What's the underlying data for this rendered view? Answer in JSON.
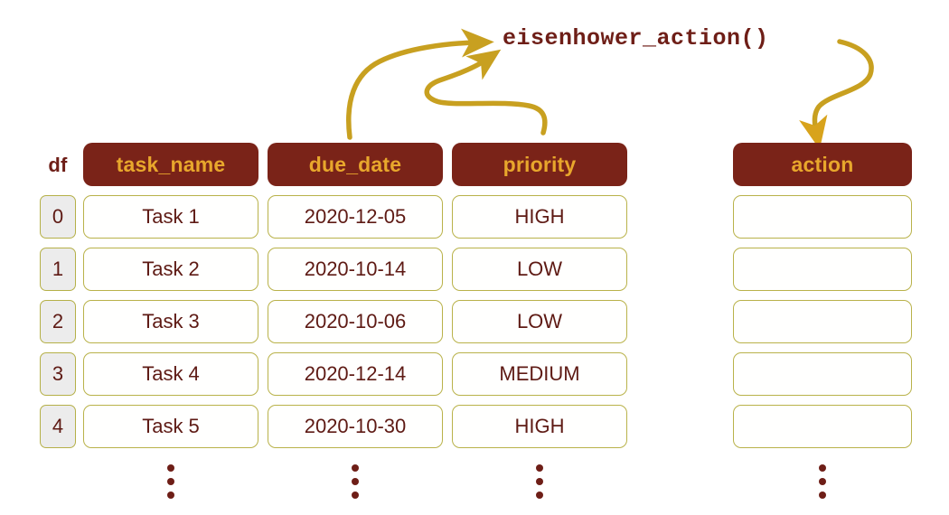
{
  "diagram": {
    "function_label": "eisenhower_action()",
    "dataframe_label": "df",
    "colors": {
      "header_bg": "#7A2318",
      "header_text": "#E8A72C",
      "cell_border": "#B9B24A",
      "cell_text": "#5E1A14",
      "index_bg": "#ECECEC",
      "arrow": "#C8A020",
      "background": "#FFFFFF"
    }
  },
  "source_table": {
    "name": "df",
    "columns": [
      "task_name",
      "due_date",
      "priority"
    ],
    "index": [
      "0",
      "1",
      "2",
      "3",
      "4"
    ],
    "rows": [
      [
        "Task 1",
        "2020-12-05",
        "HIGH"
      ],
      [
        "Task 2",
        "2020-10-14",
        "LOW"
      ],
      [
        "Task 3",
        "2020-10-06",
        "LOW"
      ],
      [
        "Task 4",
        "2020-12-14",
        "MEDIUM"
      ],
      [
        "Task 5",
        "2020-10-30",
        "HIGH"
      ]
    ],
    "truncation_indicator": "vertical-ellipsis"
  },
  "result_table": {
    "columns": [
      "action"
    ],
    "rows": [
      [
        ""
      ],
      [
        ""
      ],
      [
        ""
      ],
      [
        ""
      ],
      [
        ""
      ]
    ],
    "truncation_indicator": "vertical-ellipsis"
  },
  "arrows": [
    {
      "name": "task-name-to-function",
      "from": "task_name column",
      "to": "eisenhower_action()",
      "style": "curved-up-right"
    },
    {
      "name": "priority-to-function",
      "from": "priority column",
      "to": "eisenhower_action()",
      "style": "s-curve-up-right"
    },
    {
      "name": "function-to-action",
      "from": "eisenhower_action()",
      "to": "action column",
      "style": "s-curve-down"
    }
  ]
}
